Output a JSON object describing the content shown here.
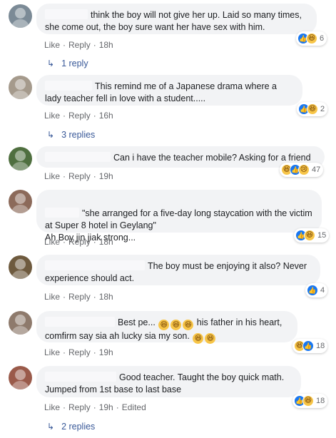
{
  "comments": [
    {
      "text": "think the boy will not give her up. Laid so many times, she come out, the boy sure want her have sex with him.",
      "avatar_color": "#7b8a96",
      "actions": {
        "like": "Like",
        "reply": "Reply",
        "time": "18h",
        "edited": ""
      },
      "reactions": {
        "icons": [
          "like-icon",
          "haha-icon"
        ],
        "count": "6"
      },
      "replies": "1 reply"
    },
    {
      "text": "This remind me of a Japanese drama where a lady teacher fell in love with a student.....",
      "avatar_color": "#a59a8c",
      "actions": {
        "like": "Like",
        "reply": "Reply",
        "time": "16h",
        "edited": ""
      },
      "reactions": {
        "icons": [
          "like-icon",
          "haha-icon"
        ],
        "count": "2"
      },
      "replies": "3 replies"
    },
    {
      "text": "Can i have the teacher mobile? Asking for a friend",
      "avatar_color": "#4f6f3f",
      "actions": {
        "like": "Like",
        "reply": "Reply",
        "time": "19h",
        "edited": ""
      },
      "reactions": {
        "icons": [
          "haha-icon",
          "like-icon",
          "sad-icon"
        ],
        "count": "47"
      },
      "replies": ""
    },
    {
      "text": "\"she arranged for a five-day long staycation with the victim at Super 8 hotel in Geylang\"\nAh Boy jin jiak strong...",
      "avatar_color": "#8c6a5a",
      "actions": {
        "like": "Like",
        "reply": "Reply",
        "time": "18h",
        "edited": ""
      },
      "reactions": {
        "icons": [
          "like-icon",
          "haha-icon"
        ],
        "count": "15"
      },
      "replies": ""
    },
    {
      "text": "The boy must be enjoying it also? Never experience should act.",
      "avatar_color": "#6e5a3e",
      "actions": {
        "like": "Like",
        "reply": "Reply",
        "time": "18h",
        "edited": ""
      },
      "reactions": {
        "icons": [
          "like-icon"
        ],
        "count": "4"
      },
      "replies": ""
    },
    {
      "text_before": "Best pe...",
      "text_after": "his father in his heart, comfirm say sia ah lucky sia my son.",
      "avatar_color": "#8e7a6c",
      "actions": {
        "like": "Like",
        "reply": "Reply",
        "time": "19h",
        "edited": ""
      },
      "reactions": {
        "icons": [
          "haha-icon",
          "like-icon"
        ],
        "count": "18"
      },
      "replies": ""
    },
    {
      "text": "Good teacher. Taught the boy quick math. Jumped from 1st base to last base",
      "avatar_color": "#9a5a4a",
      "actions": {
        "like": "Like",
        "reply": "Reply",
        "time": "19h",
        "edited": "Edited"
      },
      "reactions": {
        "icons": [
          "like-icon",
          "haha-icon"
        ],
        "count": "18"
      },
      "replies": "2 replies"
    }
  ],
  "ui": {
    "dot": "·",
    "reply_arrow": "↳"
  }
}
